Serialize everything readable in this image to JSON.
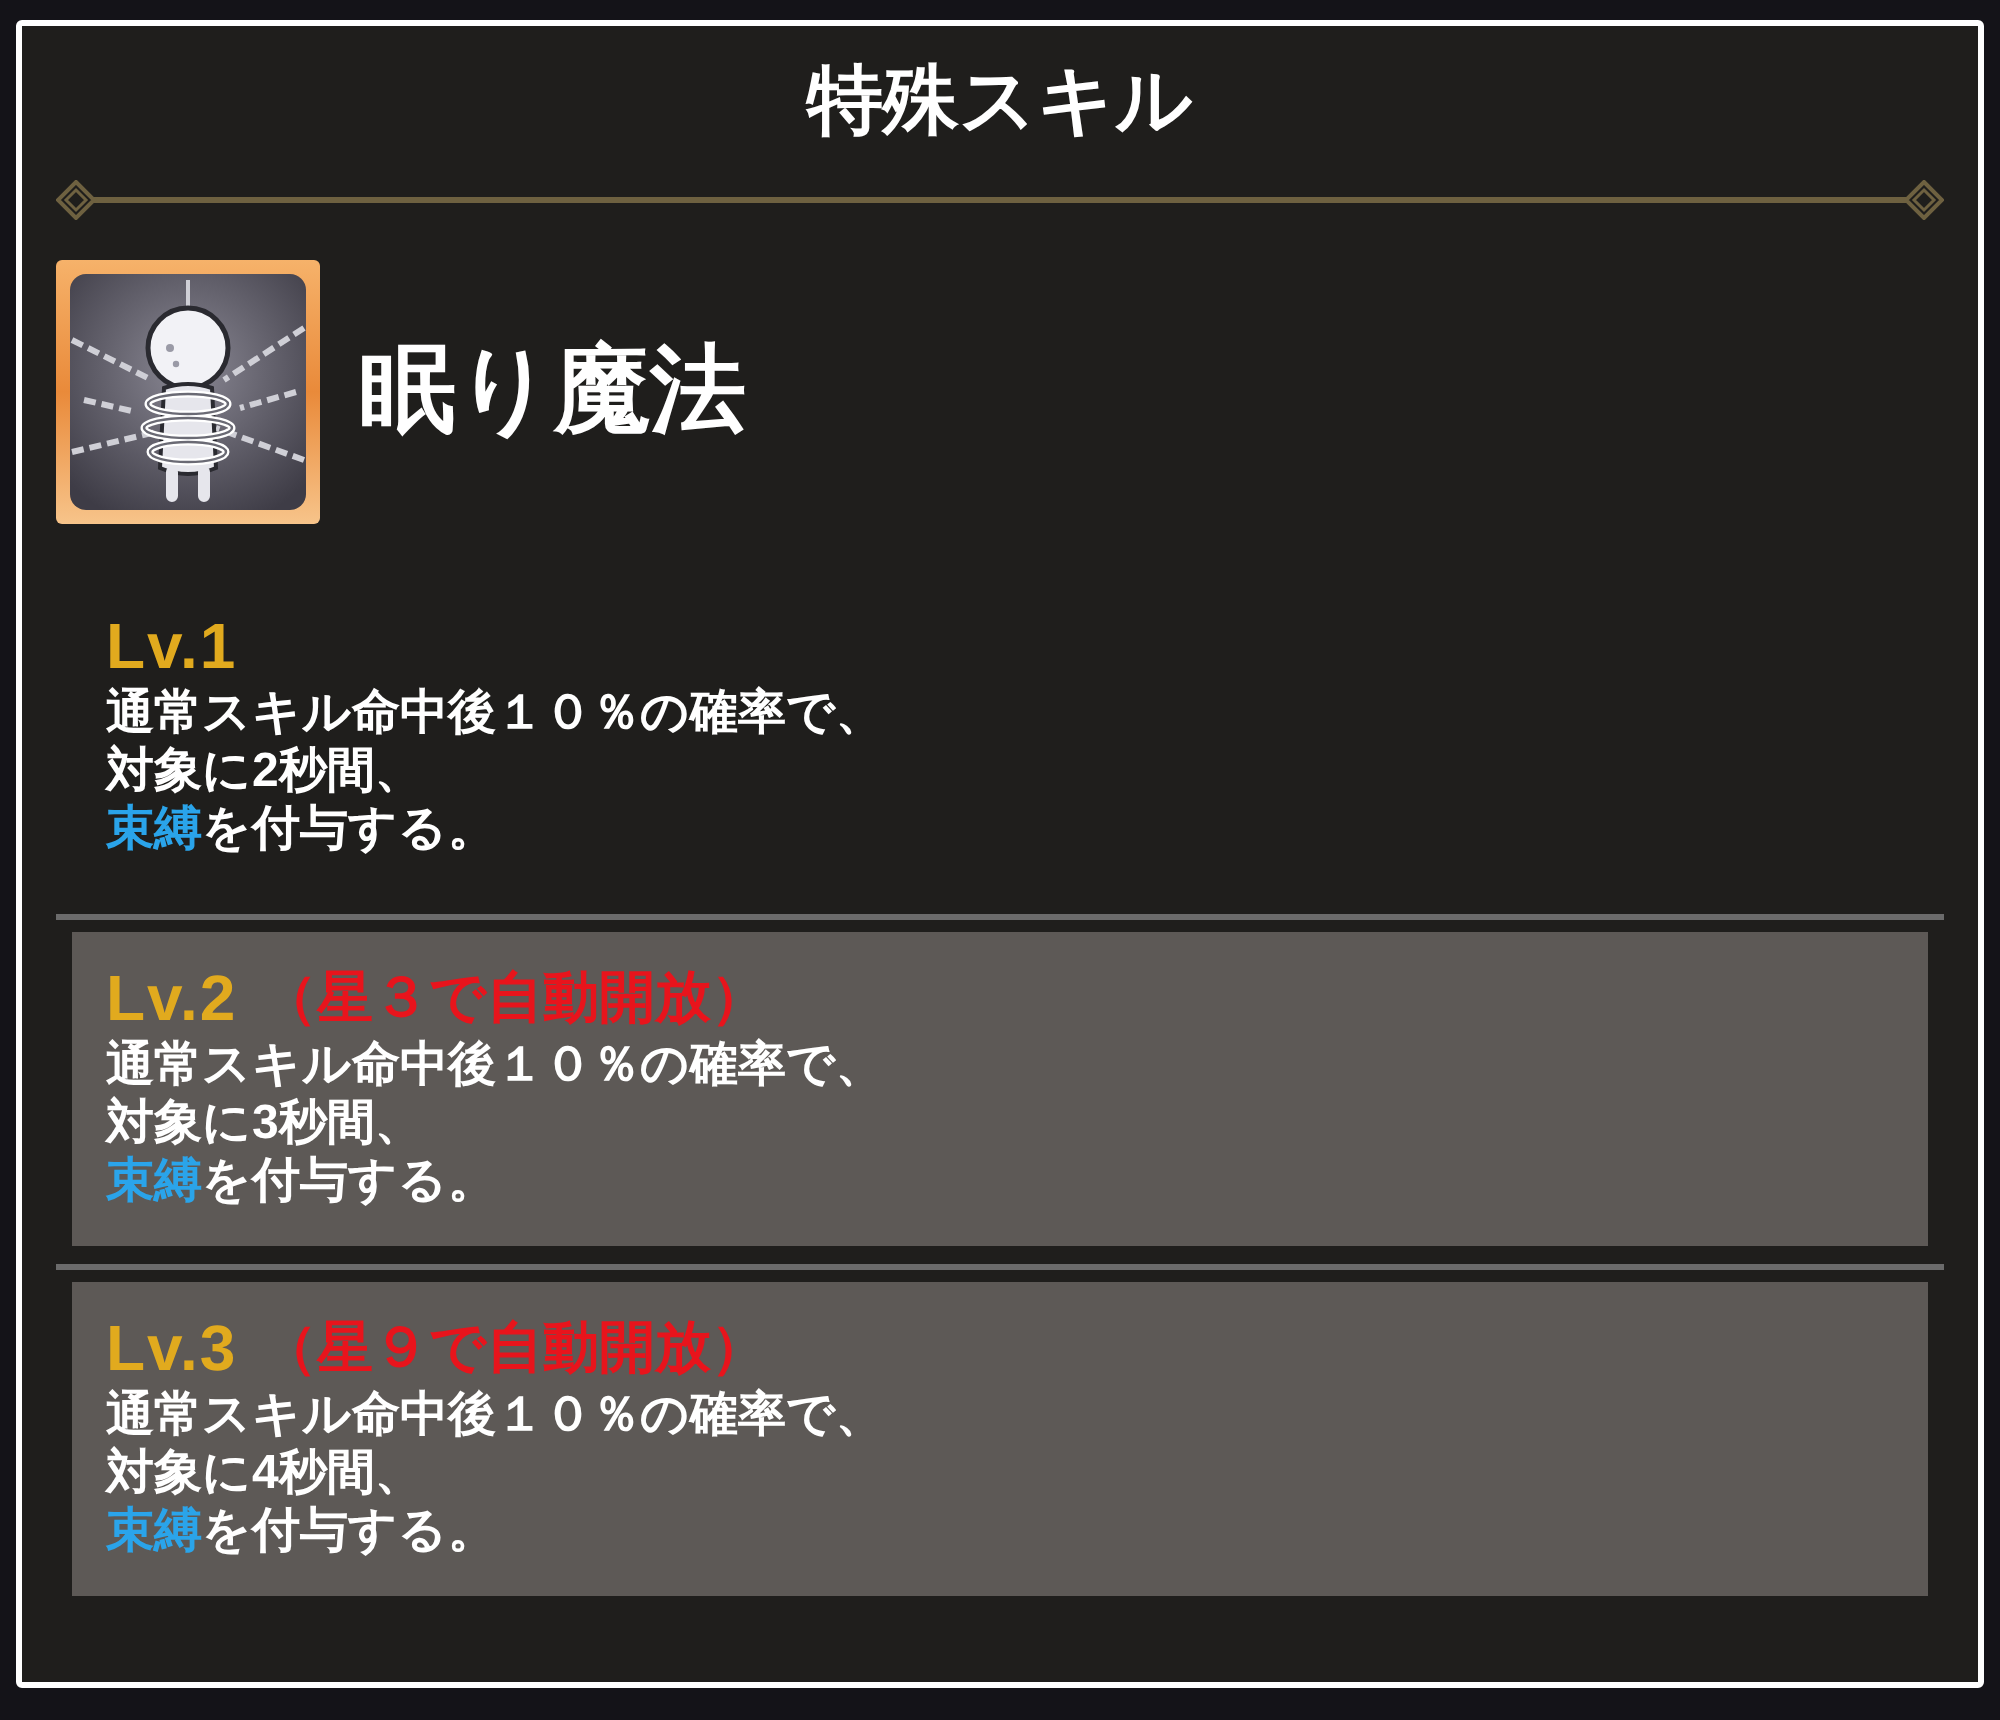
{
  "header": {
    "title": "特殊スキル"
  },
  "skill": {
    "name": "眠り魔法"
  },
  "levels": [
    {
      "label": "Lv.1",
      "locked": false,
      "lines": [
        [
          {
            "kind": "plain",
            "text": "通常スキル命中後１０％の確率で、"
          }
        ],
        [
          {
            "kind": "plain",
            "text": "対象に2秒間、"
          }
        ],
        [
          {
            "kind": "keyword",
            "text": "束縛"
          },
          {
            "kind": "plain",
            "text": "を付与する。"
          }
        ]
      ]
    },
    {
      "label": "Lv.2",
      "locked": true,
      "unlock_condition": "（星３で自動開放）",
      "lines": [
        [
          {
            "kind": "plain",
            "text": "通常スキル命中後１０％の確率で、"
          }
        ],
        [
          {
            "kind": "plain",
            "text": "対象に3秒間、"
          }
        ],
        [
          {
            "kind": "keyword",
            "text": "束縛"
          },
          {
            "kind": "plain",
            "text": "を付与する。"
          }
        ]
      ]
    },
    {
      "label": "Lv.3",
      "locked": true,
      "unlock_condition": "（星９で自動開放）",
      "lines": [
        [
          {
            "kind": "plain",
            "text": "通常スキル命中後１０％の確率で、"
          }
        ],
        [
          {
            "kind": "plain",
            "text": "対象に4秒間、"
          }
        ],
        [
          {
            "kind": "keyword",
            "text": "束縛"
          },
          {
            "kind": "plain",
            "text": "を付与する。"
          }
        ]
      ]
    }
  ]
}
